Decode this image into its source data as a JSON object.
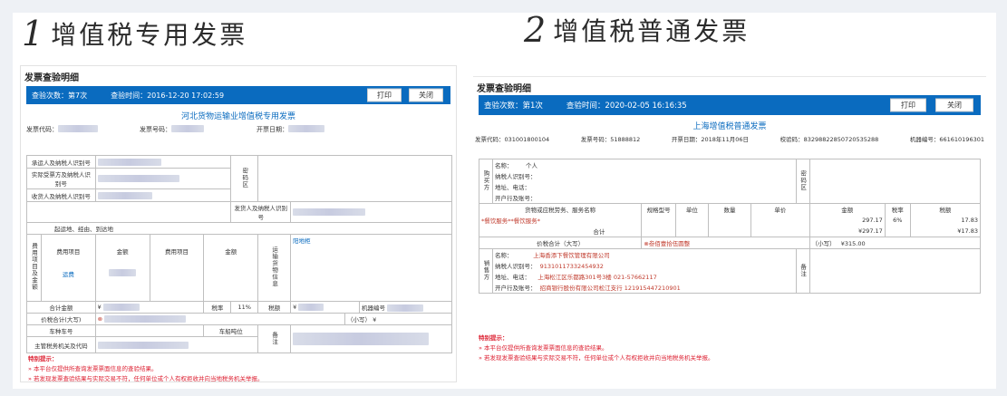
{
  "left": {
    "number": "1",
    "heading": "增值税专用发票",
    "panel_title": "发票查验明细",
    "bar": {
      "count": "查验次数：第7次",
      "time": "查验时间：2016-12-20 17:02:59",
      "print": "打印",
      "close": "关闭"
    },
    "invoice_title": "河北货物运输业增值税专用发票",
    "meta": {
      "code": "发票代码：",
      "number": "发票号码：",
      "date": "开票日期："
    },
    "rows": {
      "carrier": "承运人及纳税人识别号",
      "actual": "实际受票方及纳税人识别号",
      "receiver": "收货人及纳税人识别号",
      "password": "密码区",
      "shipper": "发货人及纳税人识别号",
      "route": "起运地、经由、到达地",
      "fee_side": "费用项目及金额",
      "fee_item": "费用项目",
      "amount": "金额",
      "fee_value": "运费",
      "cargo": "运输货物信息",
      "cargo_value": "阳地柜",
      "total": "合计金额",
      "yen": "¥",
      "tax_rate": "税率",
      "rate_value": "11%",
      "tax": "税额",
      "machine": "机器编号",
      "total_upper": "价税合计(大写)",
      "small": "（小写）",
      "vehicle": "车种车号",
      "tonnage": "车船吨位",
      "remark": "备注",
      "authority": "主管税务机关及代码"
    },
    "tips": {
      "title": "特别提示：",
      "line1": "本平台仅提供所查询发票票面信息的查验结果。",
      "line2": "若发现发票查验结果与实际交易不符，任何单位或个人有权拒收并向当地税务机关举报。"
    }
  },
  "right": {
    "number": "2",
    "heading": "增值税普通发票",
    "panel_title": "发票查验明细",
    "bar": {
      "count": "查验次数：第1次",
      "time": "查验时间：2020-02-05 16:16:35",
      "print": "打印",
      "close": "关闭"
    },
    "invoice_title": "上海增值税普通发票",
    "meta": {
      "code": "发票代码：031001800104",
      "number": "发票号码：51888812",
      "date": "开票日期：2018年11月06日",
      "check": "校验码：83298822850720535288",
      "machine": "机器编号：661610196301"
    },
    "buyer": {
      "side": "购买方",
      "name_label": "名称：",
      "name_value": "个人",
      "taxid": "纳税人识别号：",
      "addr": "地址、电话：",
      "bank": "开户行及账号：",
      "password": "密码区"
    },
    "items": {
      "headers": [
        "货物或应税劳务、服务名称",
        "规格型号",
        "单位",
        "数量",
        "单价",
        "金额",
        "税率",
        "税额"
      ],
      "row": {
        "name": "*餐饮服务**餐饮服务*",
        "amount": "297.17",
        "rate": "6%",
        "tax": "17.83"
      },
      "subtotal_label": "合计",
      "subtotal_amount": "¥297.17",
      "subtotal_tax": "¥17.83"
    },
    "total": {
      "label": "价税合计（大写）",
      "upper": "⊗叁佰壹拾伍圆整",
      "small_label": "（小写）",
      "small_value": "¥315.00"
    },
    "seller": {
      "side": "销售方",
      "name_label": "名称：",
      "name_value": "上海香添下餐饮管理有限公司",
      "taxid_label": "纳税人识别号：",
      "taxid_value": "91310117332454932",
      "addr_label": "地址、电话：",
      "addr_value": "上海松江区乐都路301号3楼 021-57662117",
      "bank_label": "开户行及账号：",
      "bank_value": "招商银行股份有限公司松江支行 121915447210901",
      "remark": "备注"
    },
    "tips": {
      "title": "特别提示：",
      "line1": "本平台仅提供所查询发票票面信息的查验结果。",
      "line2": "若发现发票查验结果与实际交易不符，任何单位或个人有权拒收并向当地税务机关举报。"
    }
  }
}
